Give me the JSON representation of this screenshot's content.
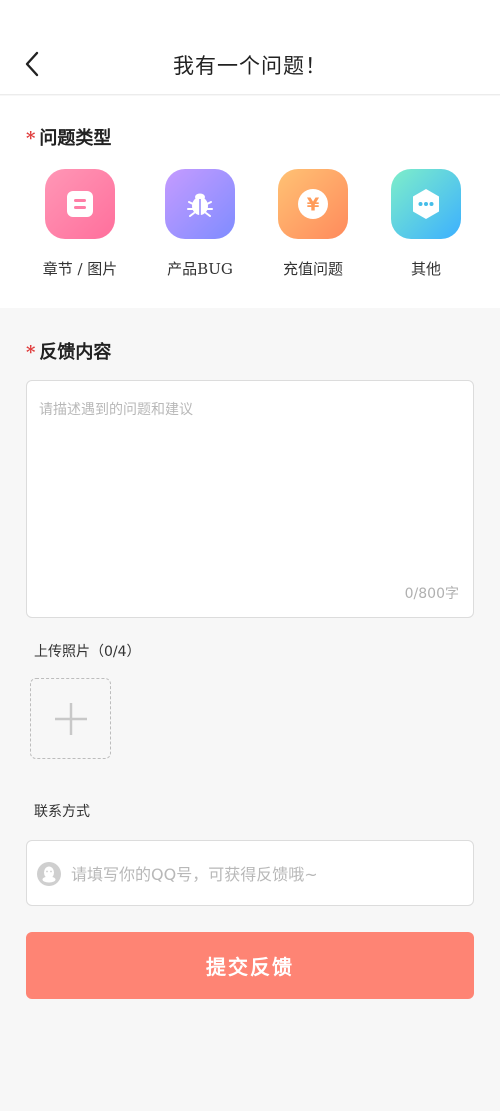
{
  "header": {
    "title": "我有一个问题！",
    "back_icon": "chevron-left-icon"
  },
  "problem_type": {
    "required_mark": "*",
    "label": "问题类型",
    "items": [
      {
        "label": "章节 / 图片",
        "icon": "chapter-image-icon",
        "color_from": "#ff97b6",
        "color_to": "#ff6f9c"
      },
      {
        "label": "产品BUG",
        "icon": "bug-icon",
        "color_from": "#c59bff",
        "color_to": "#7f8cff"
      },
      {
        "label": "充值问题",
        "icon": "yen-icon",
        "color_from": "#ffc274",
        "color_to": "#ff8a5c"
      },
      {
        "label": "其他",
        "icon": "more-dots-icon",
        "color_from": "#7eeec9",
        "color_to": "#3cb0ff"
      }
    ]
  },
  "feedback": {
    "required_mark": "*",
    "label": "反馈内容",
    "placeholder": "请描述遇到的问题和建议",
    "value": "",
    "counter": "0/800字"
  },
  "upload": {
    "label": "上传照片（0/4）",
    "add_icon": "plus-icon"
  },
  "contact": {
    "label": "联系方式",
    "placeholder": "请填写你的QQ号，可获得反馈哦~",
    "value": "",
    "icon": "qq-icon"
  },
  "submit": {
    "label": "提交反馈"
  },
  "colors": {
    "accent_required": "#e03c3c",
    "submit_bg": "#fe8474",
    "page_bg": "#f7f7f7"
  }
}
